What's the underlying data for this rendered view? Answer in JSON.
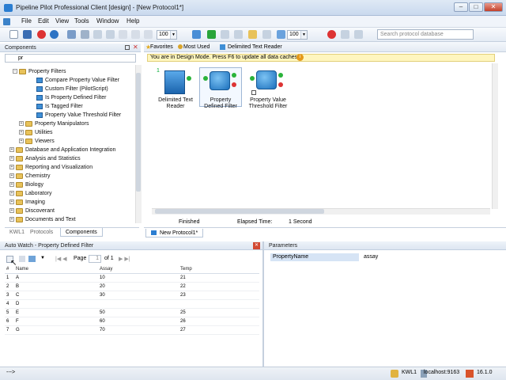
{
  "window": {
    "title": "Pipeline Pilot Professional Client [design] - [New Protocol1*]"
  },
  "menu": [
    "File",
    "Edit",
    "View",
    "Tools",
    "Window",
    "Help"
  ],
  "toolbar": {
    "zoom1": "100",
    "zoom2": "100",
    "search_placeholder": "Search protocol database"
  },
  "components_panel": {
    "title": "Components",
    "filter": "pr",
    "tree": [
      {
        "label": "Property Filters",
        "kind": "folder",
        "expanded": true,
        "level": 2
      },
      {
        "label": "Compare Property Value Filter",
        "kind": "component",
        "level": 3
      },
      {
        "label": "Custom Filter (PilotScript)",
        "kind": "component",
        "level": 3
      },
      {
        "label": "Is Property Defined Filter",
        "kind": "component",
        "level": 3
      },
      {
        "label": "Is Tagged Filter",
        "kind": "component",
        "level": 3
      },
      {
        "label": "Property Value Threshold Filter",
        "kind": "component",
        "level": 3
      },
      {
        "label": "Property Manipulators",
        "kind": "folder",
        "level": 2
      },
      {
        "label": "Utilities",
        "kind": "folder",
        "level": 2
      },
      {
        "label": "Viewers",
        "kind": "folder",
        "level": 2
      },
      {
        "label": "Database and Application Integration",
        "kind": "folder",
        "level": 1
      },
      {
        "label": "Analysis and Statistics",
        "kind": "folder",
        "level": 1
      },
      {
        "label": "Reporting and Visualization",
        "kind": "folder",
        "level": 1
      },
      {
        "label": "Chemistry",
        "kind": "folder",
        "level": 1
      },
      {
        "label": "Biology",
        "kind": "folder",
        "level": 1
      },
      {
        "label": "Laboratory",
        "kind": "folder",
        "level": 1
      },
      {
        "label": "Imaging",
        "kind": "folder",
        "level": 1
      },
      {
        "label": "Discoverant",
        "kind": "folder",
        "level": 1
      },
      {
        "label": "Documents and Text",
        "kind": "folder",
        "level": 1
      }
    ],
    "tabs": [
      "KWL1",
      "Protocols",
      "Components"
    ]
  },
  "design": {
    "tabs": [
      "Favorites",
      "Most Used",
      "Delimited Text Reader"
    ],
    "banner": "You are in Design Mode. Press F6 to update all data caches.",
    "nodes": [
      {
        "label": "Delimited Text Reader",
        "badge": "1"
      },
      {
        "label": "Property Defined Filter",
        "badge": ""
      },
      {
        "label": "Property Value Threshold Filter",
        "badge": ""
      }
    ],
    "status": {
      "state": "Finished",
      "elapsed_label": "Elapsed Time:",
      "elapsed_value": "1 Second"
    },
    "doc_tab": "New Protocol1*"
  },
  "autowatch": {
    "title": "Auto Watch - Property Defined Filter",
    "page_label": "Page",
    "page_value": "1",
    "page_of": "of 1",
    "columns": [
      "Name",
      "Assay",
      "Temp"
    ],
    "rows": [
      [
        "1",
        "A",
        "10",
        "21"
      ],
      [
        "2",
        "B",
        "20",
        "22"
      ],
      [
        "3",
        "C",
        "30",
        "23"
      ],
      [
        "4",
        "D",
        "",
        ""
      ],
      [
        "5",
        "E",
        "50",
        "25"
      ],
      [
        "6",
        "F",
        "60",
        "26"
      ],
      [
        "7",
        "G",
        "70",
        "27"
      ]
    ]
  },
  "parameters": {
    "title": "Parameters",
    "name": "PropertyName",
    "value": "assay"
  },
  "statusbar": {
    "left": "--->",
    "user": "KWL1",
    "server": "localhost:9163",
    "version": "16.1.0"
  }
}
